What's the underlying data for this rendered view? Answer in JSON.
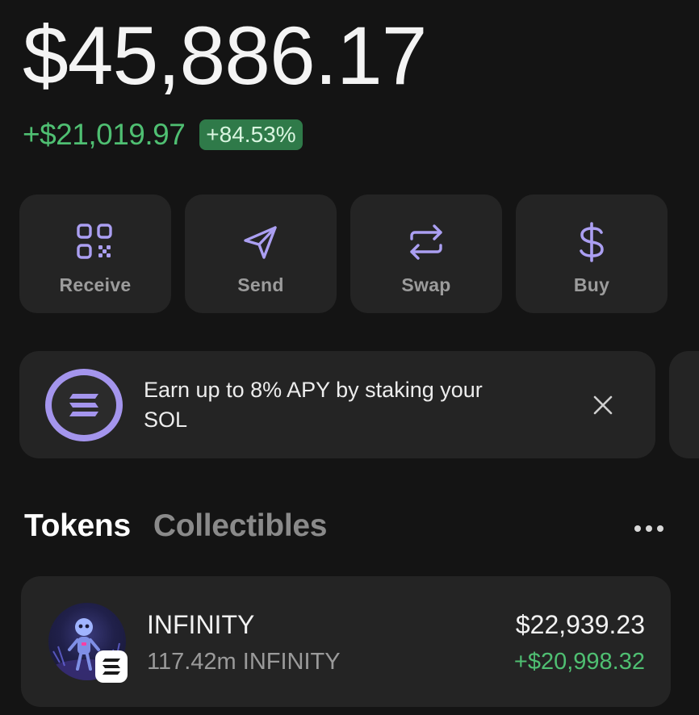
{
  "balance": {
    "total": "$45,886.17",
    "change_amount": "+$21,019.97",
    "change_percent": "+84.53%"
  },
  "actions": [
    {
      "label": "Receive",
      "icon": "qr-code-icon"
    },
    {
      "label": "Send",
      "icon": "send-icon"
    },
    {
      "label": "Swap",
      "icon": "swap-icon"
    },
    {
      "label": "Buy",
      "icon": "dollar-icon"
    }
  ],
  "banner": {
    "text": "Earn up to 8% APY by staking your SOL",
    "icon": "solana-icon",
    "close_icon": "close-icon"
  },
  "tabs": [
    {
      "label": "Tokens",
      "active": true
    },
    {
      "label": "Collectibles",
      "active": false
    }
  ],
  "more_icon": "more-icon",
  "tokens": [
    {
      "name": "INFINITY",
      "quantity": "117.42m INFINITY",
      "value": "$22,939.23",
      "change": "+$20,998.32",
      "chain_icon": "solana-icon"
    }
  ],
  "colors": {
    "background": "#141414",
    "card": "#242424",
    "accent_purple": "#a495ed",
    "positive_green": "#4fbf72",
    "badge_green": "#2f7a49"
  }
}
